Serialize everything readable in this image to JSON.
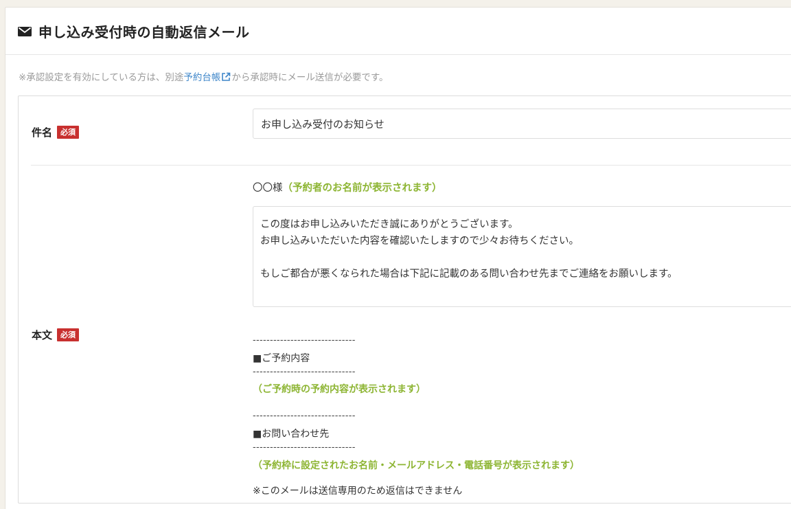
{
  "header": {
    "title": "申し込み受付時の自動返信メール",
    "icon": "envelope-icon"
  },
  "notice": {
    "prefix": "※承認設定を有効にしている方は、別途",
    "link_text": "予約台帳",
    "suffix": "から承認時にメール送信が必要です。"
  },
  "subject": {
    "label": "件名",
    "required_badge": "必須",
    "value": "お申し込み受付のお知らせ"
  },
  "body": {
    "label": "本文",
    "required_badge": "必須",
    "salutation": "〇〇様",
    "salutation_hint": "（予約者のお名前が表示されます）",
    "textarea_value": "この度はお申し込みいただき誠にありがとうございます。\nお申し込みいただいた内容を確認いたしますので少々お待ちください。\n\nもしご都合が悪くなられた場合は下記に記載のある問い合わせ先までご連絡をお願いします。",
    "divider": "------------------------------",
    "reservation_heading": "■ご予約内容",
    "reservation_hint": "（ご予約時の予約内容が表示されます）",
    "contact_heading": "■お問い合わせ先",
    "contact_hint": "（予約枠に設定されたお名前・メールアドレス・電話番号が表示されます）",
    "footer_note": "※このメールは送信専用のため返信はできません"
  },
  "colors": {
    "required": "#c8302f",
    "hint": "#8db533",
    "link": "#3e86c9"
  }
}
